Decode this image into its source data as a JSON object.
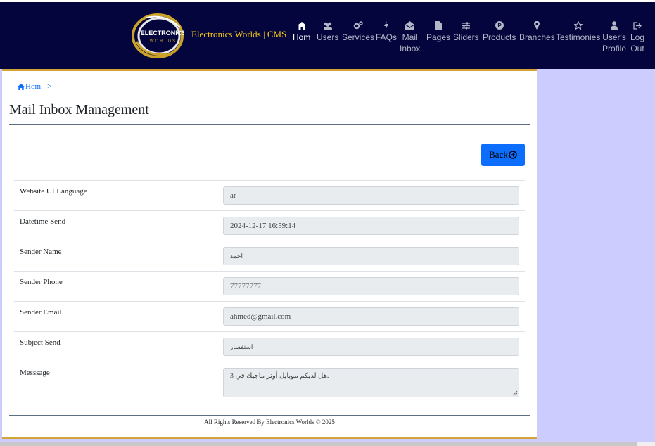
{
  "brand": {
    "logo_line1": "ELECTRONICS",
    "logo_line2": "WORLDS",
    "name": "Electronics Worlds | CMS"
  },
  "nav": [
    {
      "label1": "Hom",
      "label2": "",
      "icon": "home-icon",
      "active": true
    },
    {
      "label1": "Users",
      "label2": "",
      "icon": "users-icon"
    },
    {
      "label1": "Services",
      "label2": "",
      "icon": "cogs-icon"
    },
    {
      "label1": "FAQs",
      "label2": "",
      "icon": "bolt-icon"
    },
    {
      "label1": "Mail",
      "label2": "Inbox",
      "icon": "envelope-open-icon"
    },
    {
      "label1": "Pages",
      "label2": "",
      "icon": "file-icon"
    },
    {
      "label1": "Sliders",
      "label2": "",
      "icon": "sliders-icon"
    },
    {
      "label1": "Products",
      "label2": "",
      "icon": "product-icon"
    },
    {
      "label1": "Branches",
      "label2": "",
      "icon": "map-pin-icon"
    },
    {
      "label1": "Testimonies",
      "label2": "",
      "icon": "star-icon"
    },
    {
      "label1": "User's",
      "label2": "Profile",
      "icon": "user-icon"
    },
    {
      "label1": "Log",
      "label2": "Out",
      "icon": "logout-icon"
    }
  ],
  "breadcrumb": {
    "home": "Hom - >"
  },
  "page_title": "Mail Inbox Management",
  "back_button": "Back",
  "fields": [
    {
      "label": "Website UI Language",
      "value": "ar"
    },
    {
      "label": "Datetime Send",
      "value": "2024-12-17 16:59:14"
    },
    {
      "label": "Sender Name",
      "value": "احمد"
    },
    {
      "label": "Sender Phone",
      "value": "77777777"
    },
    {
      "label": "Sender Email",
      "value": "ahmed@gmail.com"
    },
    {
      "label": "Subject Send",
      "value": "استفسار"
    },
    {
      "label": "Messsage",
      "value": "هل لديكم موبايل أونر ماجيك في 3."
    }
  ],
  "footer": "All Rights Reserved By Electronics Worlds © 2025",
  "colors": {
    "navbar": "#03053c",
    "accent": "#d4a437",
    "brand_text": "#f5c518",
    "button": "#0d6efd",
    "page_bg": "#ccccff"
  }
}
